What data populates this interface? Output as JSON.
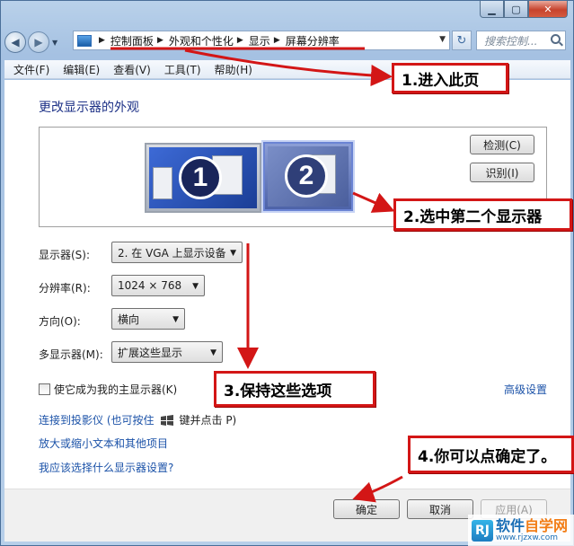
{
  "window": {
    "caption": {
      "minimize": "▁",
      "maximize": "▢",
      "close": "✕"
    }
  },
  "nav": {
    "back_icon": "back-arrow-icon",
    "forward_icon": "forward-arrow-icon",
    "breadcrumb": [
      "控制面板",
      "外观和个性化",
      "显示",
      "屏幕分辨率"
    ],
    "search_placeholder": "搜索控制...",
    "refresh_glyph": "↻"
  },
  "menu": {
    "items": [
      "文件(F)",
      "编辑(E)",
      "查看(V)",
      "工具(T)",
      "帮助(H)"
    ]
  },
  "page": {
    "heading": "更改显示器的外观",
    "detect_button": "检测(C)",
    "identify_button": "识别(I)",
    "monitor1_number": "1",
    "monitor2_number": "2",
    "fields": {
      "display_label": "显示器(S):",
      "display_value": "2. 在 VGA 上显示设备",
      "resolution_label": "分辨率(R):",
      "resolution_value": "1024 × 768",
      "orientation_label": "方向(O):",
      "orientation_value": "横向",
      "multi_label": "多显示器(M):",
      "multi_value": "扩展这些显示"
    },
    "primary_checkbox_label": "使它成为我的主显示器(K)",
    "advanced_link": "高级设置",
    "projector_link": "连接到投影仪 (也可按住",
    "projector_link_suffix": "键并点击 P)",
    "text_size_link": "放大或缩小文本和其他项目",
    "which_settings_link": "我应该选择什么显示器设置?",
    "ok_button": "确定",
    "cancel_button": "取消",
    "apply_button": "应用(A)"
  },
  "annotations": {
    "step1": "1.进入此页",
    "step2": "2.选中第二个显示器",
    "step3": "3.保持这些选项",
    "step4": "4.你可以点确定了。",
    "color": "#d31616"
  },
  "watermark": {
    "logo": "RJ",
    "name_a": "软件",
    "name_b": "自学网",
    "url": "www.rjzxw.com"
  }
}
